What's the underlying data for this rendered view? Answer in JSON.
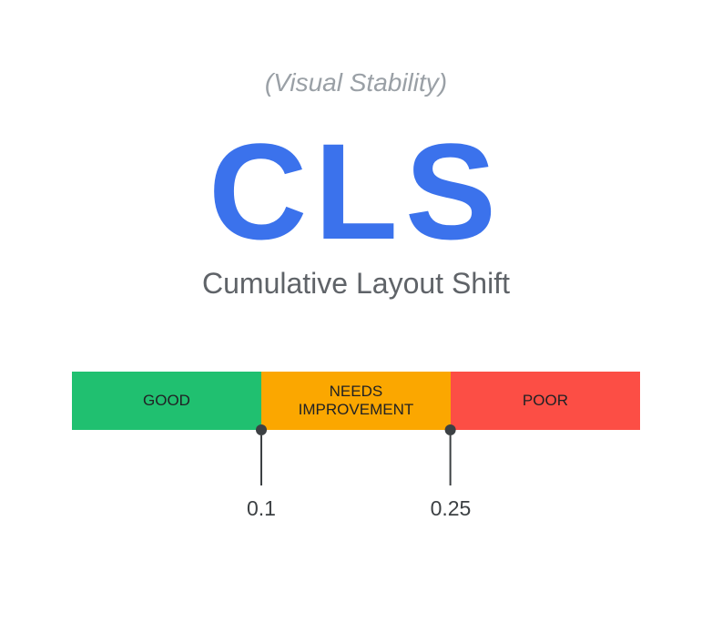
{
  "header": {
    "category": "(Visual Stability)",
    "abbreviation": "CLS",
    "full_name": "Cumulative Layout Shift"
  },
  "scale": {
    "segments": [
      {
        "label": "GOOD",
        "color": "#20c070"
      },
      {
        "label": "NEEDS\nIMPROVEMENT",
        "color": "#fba700"
      },
      {
        "label": "POOR",
        "color": "#fc4e45"
      }
    ],
    "thresholds": [
      {
        "value": "0.1"
      },
      {
        "value": "0.25"
      }
    ]
  }
}
